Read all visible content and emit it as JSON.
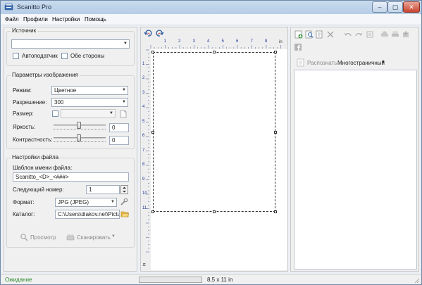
{
  "window": {
    "title": "Scanitto Pro",
    "controls": {
      "minimize": "–",
      "maximize": "▢",
      "close": "✕"
    }
  },
  "menu": {
    "items": [
      "Файл",
      "Профили",
      "Настройки",
      "Помощь"
    ]
  },
  "source": {
    "group_title": "Источник",
    "device_value": "",
    "adf_label": "Автоподатчик",
    "adf_checked": false,
    "duplex_label": "Обе стороны",
    "duplex_checked": false
  },
  "image_params": {
    "group_title": "Параметры изображения",
    "mode_label": "Режим:",
    "mode_value": "Цветное",
    "resolution_label": "Разрешение:",
    "resolution_value": "300",
    "size_label": "Размер:",
    "size_checked": false,
    "size_value": "",
    "brightness_label": "Яркость:",
    "brightness_value": "0",
    "contrast_label": "Контрастность:",
    "contrast_value": "0"
  },
  "file_settings": {
    "group_title": "Настройки файла",
    "template_label": "Шаблон имени файла:",
    "template_value": "Scanitto_<D>_<###>",
    "next_number_label": "Следующий номер:",
    "next_number_value": "1",
    "format_label": "Формат:",
    "format_value": "JPG (JPEG)",
    "folder_label": "Каталог:",
    "folder_value": "C:\\Users\\diakov.net\\Pictures\\"
  },
  "actions": {
    "preview_label": "Просмотр",
    "scan_label": "Сканировать"
  },
  "preview": {
    "ruler_unit": "in",
    "ruler_top": [
      "1",
      "2",
      "3",
      "4",
      "5",
      "6",
      "7",
      "8"
    ],
    "ruler_left": [
      "1",
      "2",
      "3",
      "4",
      "5",
      "6",
      "7",
      "8",
      "9",
      "10",
      "11"
    ],
    "page_size_text": "8,5 x 11 in"
  },
  "right": {
    "recognize_label": "Распознать",
    "page_mode_value": "Многостраничный"
  },
  "status": {
    "text": "Ожидание",
    "progress_fraction": 0,
    "page_size": "8,5 x 11 in"
  },
  "colors": {
    "status_text": "#2f8a2f",
    "ruler_text": "#1f3a9a"
  }
}
